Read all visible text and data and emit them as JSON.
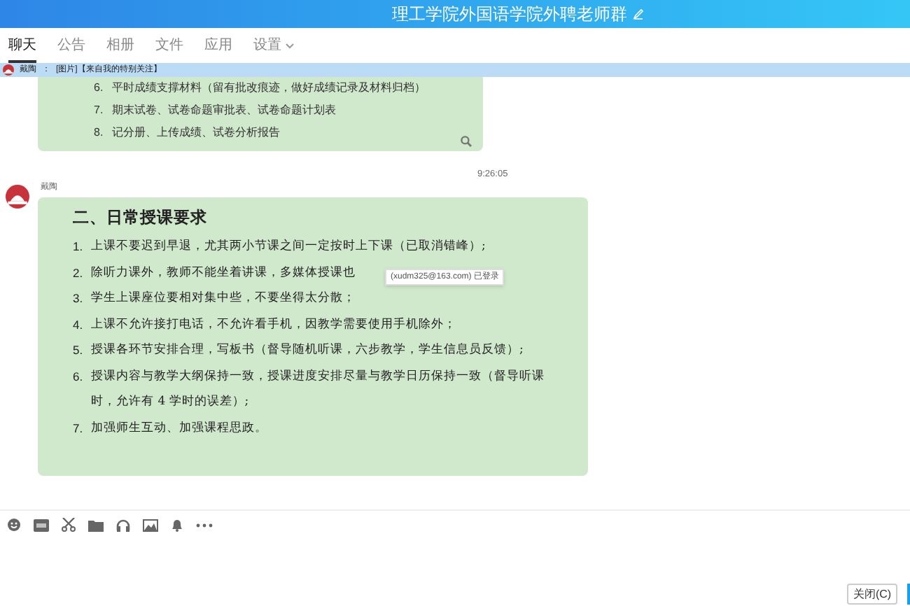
{
  "window": {
    "title": "理工学院外国语学院外聘老师群"
  },
  "tabs": [
    {
      "label": "聊天",
      "selected": true
    },
    {
      "label": "公告",
      "selected": false
    },
    {
      "label": "相册",
      "selected": false
    },
    {
      "label": "文件",
      "selected": false
    },
    {
      "label": "应用",
      "selected": false
    },
    {
      "label": "设置",
      "selected": false
    }
  ],
  "notice": {
    "sender": "戴陶",
    "separator": "：",
    "text": "[图片]【来自我的特别关注】"
  },
  "messages": [
    {
      "kind": "partial",
      "items": [
        {
          "number": "6.",
          "text": "平时成绩支撑材料（留有批改痕迹，做好成绩记录及材料归档）"
        },
        {
          "number": "7.",
          "text": "期末试卷、试卷命题审批表、试卷命题计划表"
        },
        {
          "number": "8.",
          "text": "记分册、上传成绩、试卷分析报告"
        }
      ]
    },
    {
      "kind": "timestamp",
      "text": "9:26:05"
    },
    {
      "kind": "full",
      "sender": "戴陶",
      "heading": "二、日常授课要求",
      "items": [
        {
          "number": "1.",
          "text": "上课不要迟到早退，尤其两小节课之间一定按时上下课（已取消错峰）;"
        },
        {
          "number": "2.",
          "text": "除听力课外，教师不能坐着讲课，多媒体授课也"
        },
        {
          "number": "3.",
          "text": "学生上课座位要相对集中些，不要坐得太分散；"
        },
        {
          "number": "4.",
          "text": "上课不允许接打电话，不允许看手机，因教学需要使用手机除外；"
        },
        {
          "number": "5.",
          "text": "授课各环节安排合理，写板书（督导随机听课，六步教学，学生信息员反馈）;"
        },
        {
          "number": "6.",
          "text": "授课内容与教学大纲保持一致，授课进度安排尽量与教学日历保持一致（督导听课时，允许有 4 学时的误差）;"
        },
        {
          "number": "7.",
          "text": "加强师生互动、加强课程思政。"
        }
      ]
    }
  ],
  "tooltip": {
    "text": "(xudm325@163.com) 已登录"
  },
  "close_button": {
    "label": "关闭(C)"
  }
}
